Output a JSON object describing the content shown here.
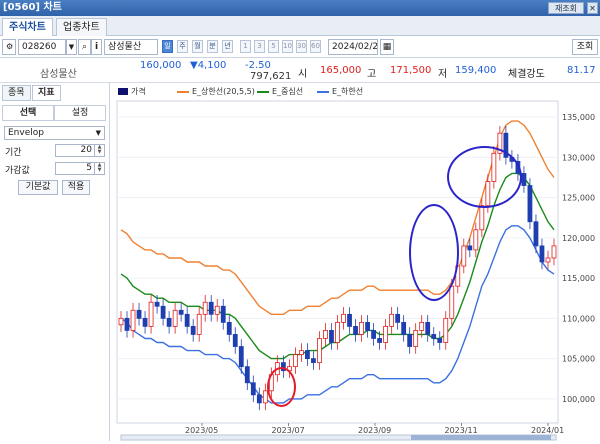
{
  "window": {
    "title": "[0560] 차트",
    "right_button": "재조회"
  },
  "tabs": [
    {
      "label": "주식차트",
      "active": true
    },
    {
      "label": "업종차트",
      "active": false
    }
  ],
  "toolbar": {
    "code": "028260",
    "stock_name": "삼성물산",
    "periods": [
      "일",
      "주",
      "월",
      "분",
      "년",
      "1",
      "3",
      "5",
      "10",
      "30",
      "60"
    ],
    "selected_period": "일",
    "date": "2024/02/2",
    "search_button": "조회"
  },
  "quote": {
    "name": "삼성물산",
    "price": "160,000",
    "change": "▼4,100",
    "change_pct": "-2.50",
    "volume": "797,621",
    "open_label": "시",
    "open": "165,000",
    "high_label": "고",
    "high": "171,500",
    "low_label": "저",
    "low": "159,400",
    "strength_label": "체결강도",
    "strength": "81.17",
    "colors": {
      "up": "#e02020",
      "down": "#1f5fd6"
    }
  },
  "left_panel": {
    "tabs": [
      "종목",
      "지표"
    ],
    "subtabs": [
      "선택",
      "설정"
    ],
    "indicator": "Envelop",
    "params": [
      {
        "label": "기간",
        "value": "20"
      },
      {
        "label": "가감값",
        "value": "5"
      }
    ],
    "buttons": [
      "기본값",
      "적용"
    ]
  },
  "chart_data": {
    "type": "line",
    "legend": [
      {
        "name": "가격",
        "color": "#101070"
      },
      {
        "name": "E_상한선(20,5,5)",
        "color": "#f08030"
      },
      {
        "name": "E_중심선",
        "color": "#1a8a1a"
      },
      {
        "name": "E_하한선",
        "color": "#3a70e0"
      }
    ],
    "x_ticks": [
      "2023/05",
      "2023/07",
      "2023/09",
      "2023/11",
      "2024/01"
    ],
    "y_ticks": [
      "100,000",
      "105,000",
      "110,000",
      "115,000",
      "120,000",
      "125,000",
      "130,000",
      "135,000"
    ],
    "ylim": [
      97000,
      137000
    ],
    "price": [
      110000,
      108500,
      111000,
      110000,
      109000,
      112000,
      111500,
      110000,
      109000,
      111000,
      110500,
      109000,
      108000,
      110500,
      112000,
      110500,
      111500,
      109500,
      108000,
      106500,
      104000,
      102000,
      100500,
      99500,
      101000,
      103000,
      104500,
      103500,
      104000,
      105500,
      106000,
      105000,
      104500,
      107500,
      108500,
      107000,
      109500,
      110500,
      109000,
      108000,
      109500,
      108500,
      107500,
      107000,
      109000,
      110500,
      109500,
      108000,
      106500,
      108500,
      109500,
      108000,
      107500,
      107000,
      110000,
      114000,
      116500,
      119000,
      118500,
      121000,
      124000,
      127000,
      130500,
      133000,
      130000,
      129500,
      128000,
      126500,
      122000,
      119000,
      117000,
      117500,
      119000
    ],
    "upper": [
      121000,
      120500,
      119500,
      119000,
      118500,
      118500,
      118000,
      118000,
      117500,
      117500,
      117500,
      117000,
      117000,
      117000,
      116500,
      116500,
      116500,
      116000,
      116000,
      115500,
      114500,
      113500,
      112500,
      111500,
      111000,
      110500,
      110500,
      110500,
      111000,
      111000,
      111000,
      111500,
      111500,
      111500,
      112000,
      112500,
      112500,
      113000,
      113500,
      113500,
      113500,
      114000,
      114000,
      113500,
      113500,
      113500,
      113500,
      113500,
      113500,
      113500,
      113500,
      113500,
      113000,
      113000,
      113500,
      114500,
      116000,
      118000,
      120000,
      122500,
      125000,
      127500,
      130000,
      132500,
      134000,
      134500,
      134500,
      134000,
      133000,
      131500,
      130000,
      128500,
      127500
    ],
    "middle": [
      115500,
      115000,
      114000,
      113500,
      113000,
      113000,
      112500,
      112500,
      112000,
      112000,
      112000,
      111500,
      111500,
      111500,
      111000,
      111000,
      111000,
      110500,
      110500,
      110000,
      109000,
      108000,
      107000,
      106000,
      105500,
      105000,
      105000,
      105000,
      105500,
      105500,
      105500,
      106000,
      106000,
      106000,
      106500,
      107000,
      107000,
      107500,
      108000,
      108000,
      108000,
      108500,
      108500,
      108000,
      108000,
      108000,
      108000,
      108000,
      108000,
      108000,
      108000,
      108000,
      107500,
      107500,
      108000,
      109000,
      110500,
      112500,
      114500,
      117000,
      119500,
      121500,
      124000,
      126000,
      127500,
      128000,
      128000,
      127500,
      126500,
      125000,
      123500,
      122000,
      121000
    ],
    "lower": [
      110000,
      109500,
      108500,
      108000,
      107500,
      107500,
      107000,
      107000,
      106500,
      106500,
      106500,
      106000,
      106000,
      106000,
      105500,
      105500,
      105500,
      105000,
      105000,
      104500,
      103500,
      102500,
      101500,
      100500,
      100000,
      99500,
      99500,
      99500,
      100000,
      100000,
      100000,
      100500,
      100500,
      100500,
      101000,
      101500,
      101500,
      102000,
      102500,
      102500,
      102500,
      103000,
      103000,
      102500,
      102500,
      102500,
      102500,
      102500,
      102500,
      102500,
      102500,
      102500,
      102000,
      102000,
      102500,
      103500,
      105000,
      107000,
      109000,
      111500,
      114000,
      115500,
      117500,
      119500,
      121000,
      121500,
      121500,
      121000,
      120000,
      118500,
      117000,
      116000,
      115500
    ]
  }
}
